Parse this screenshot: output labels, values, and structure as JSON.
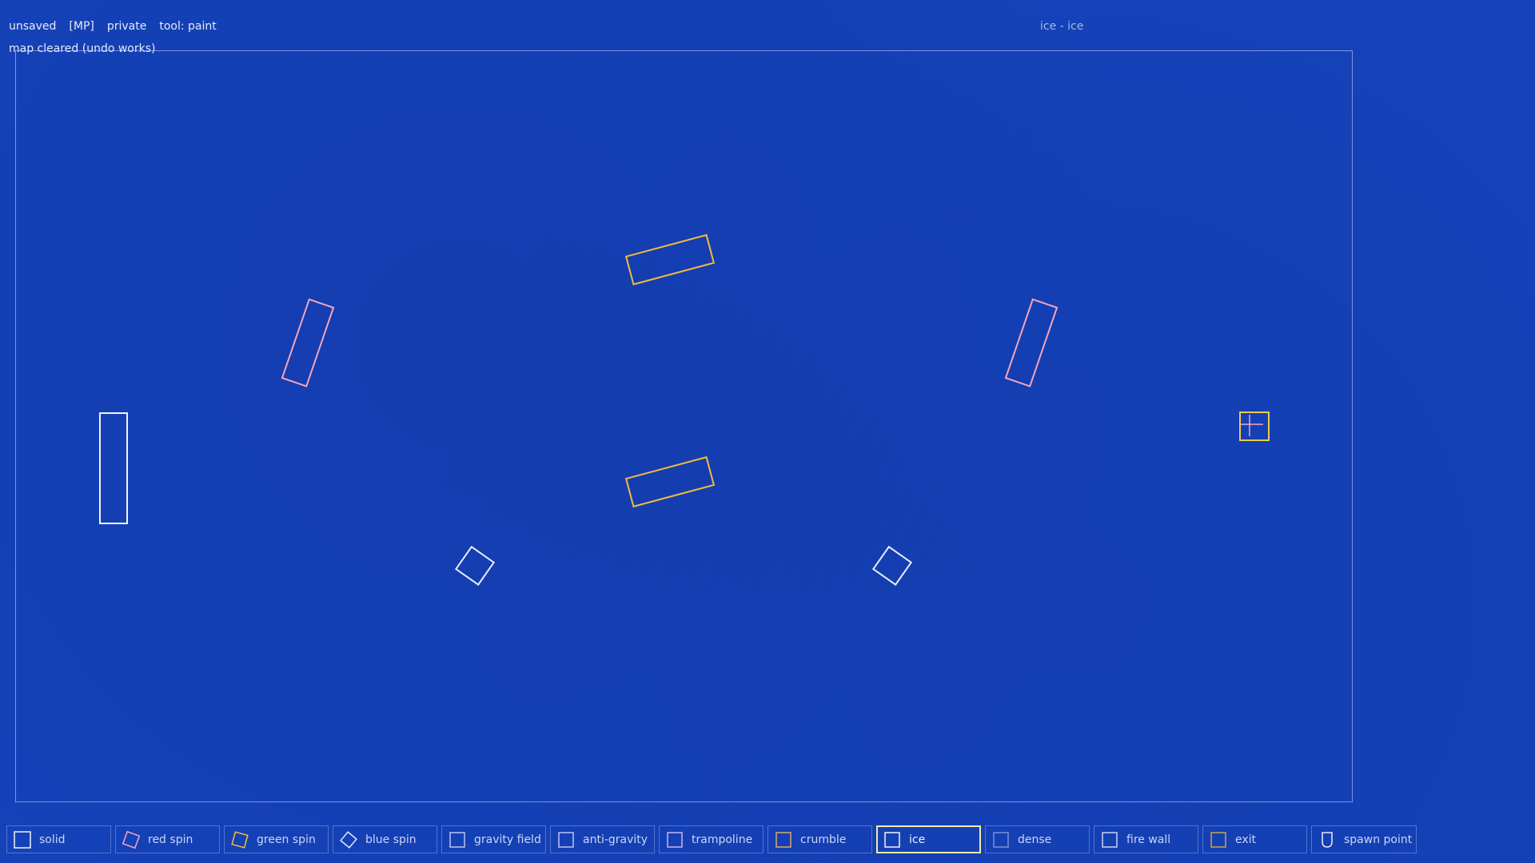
{
  "status": {
    "save_state": "unsaved",
    "mode": "[MP]",
    "visibility": "private",
    "tool": "tool: paint",
    "message": "map cleared (undo works)"
  },
  "map_title": "ice - ice",
  "colors": {
    "background": "#1542b9",
    "solid": "#f2f4fb",
    "red_spin": "#f3a6c0",
    "green_spin": "#f2bb3c",
    "blue_spin": "#e6ecfb",
    "exit": "#f2c94c",
    "selected_border": "#f4e9a8"
  },
  "palette": [
    {
      "id": "solid",
      "label": "solid",
      "icon": "square-outline-icon",
      "color": "#f2f4fb"
    },
    {
      "id": "red-spin",
      "label": "red spin",
      "icon": "rotated-square-icon",
      "color": "#f3a6c0"
    },
    {
      "id": "green-spin",
      "label": "green spin",
      "icon": "rotated-square-icon",
      "color": "#f2bb3c"
    },
    {
      "id": "blue-spin",
      "label": "blue spin",
      "icon": "diamond-icon",
      "color": "#e6ecfb"
    },
    {
      "id": "gravity-field",
      "label": "gravity field",
      "icon": "square-outline-icon",
      "color": "#b9c6ee"
    },
    {
      "id": "anti-gravity",
      "label": "anti-gravity",
      "icon": "square-outline-icon",
      "color": "#b9c6ee"
    },
    {
      "id": "trampoline",
      "label": "trampoline",
      "icon": "square-outline-icon",
      "color": "#c9b6ee"
    },
    {
      "id": "crumble",
      "label": "crumble",
      "icon": "square-outline-icon",
      "color": "#e2a36a"
    },
    {
      "id": "ice",
      "label": "ice",
      "icon": "square-outline-icon",
      "color": "#f2f4fb",
      "selected": true
    },
    {
      "id": "dense",
      "label": "dense",
      "icon": "square-outline-icon",
      "color": "#7f8fd8"
    },
    {
      "id": "fire-wall",
      "label": "fire wall",
      "icon": "square-outline-icon",
      "color": "#c9d2f2"
    },
    {
      "id": "exit",
      "label": "exit",
      "icon": "square-outline-icon",
      "color": "#c9a542"
    },
    {
      "id": "spawn-point",
      "label": "spawn point",
      "icon": "shield-icon",
      "color": "#e6ecfb"
    }
  ],
  "map_pieces": [
    {
      "name": "solid-block",
      "type": "solid"
    },
    {
      "name": "red-spin-block-left",
      "type": "red spin"
    },
    {
      "name": "red-spin-block-right",
      "type": "red spin"
    },
    {
      "name": "green-spin-block-top",
      "type": "green spin"
    },
    {
      "name": "green-spin-block-bottom",
      "type": "green spin"
    },
    {
      "name": "blue-spin-block-left",
      "type": "blue spin"
    },
    {
      "name": "blue-spin-block-right",
      "type": "blue spin"
    },
    {
      "name": "exit-block",
      "type": "exit"
    }
  ]
}
